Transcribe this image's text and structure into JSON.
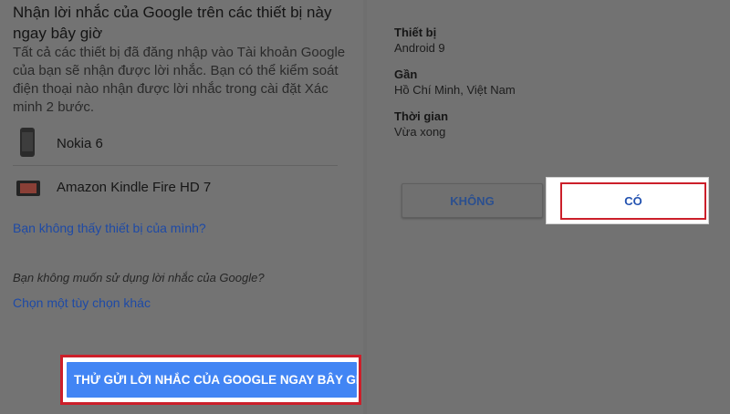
{
  "left": {
    "heading": "Nhận lời nhắc của Google trên các thiết bị này ngay bây giờ",
    "description": "Tất cả các thiết bị đã đăng nhập vào Tài khoản Google của bạn sẽ nhận được lời nhắc. Bạn có thể kiểm soát điện thoại nào nhận được lời nhắc trong cài đặt Xác minh 2 bước.",
    "devices": [
      {
        "name": "Nokia 6",
        "icon": "phone-icon"
      },
      {
        "name": "Amazon Kindle Fire HD 7",
        "icon": "tablet-icon"
      }
    ],
    "no_device_link": "Bạn không thấy thiết bị của mình?",
    "other_question": "Bạn không muốn sử dụng lời nhắc của Google?",
    "other_option_link": "Chọn một tùy chọn khác",
    "send_button": "THỬ GỬI LỜI NHẮC CỦA GOOGLE NGAY BÂY GIỜ"
  },
  "right": {
    "device_label": "Thiết bị",
    "device_value": "Android 9",
    "near_label": "Gần",
    "near_value": "Hồ Chí Minh, Việt Nam",
    "time_label": "Thời gian",
    "time_value": "Vừa xong",
    "no_button": "KHÔNG",
    "yes_button": "CÓ"
  },
  "colors": {
    "link": "#1e4aa6",
    "primary_button": "#4285f4",
    "highlight_outline": "#cc1f2a"
  }
}
